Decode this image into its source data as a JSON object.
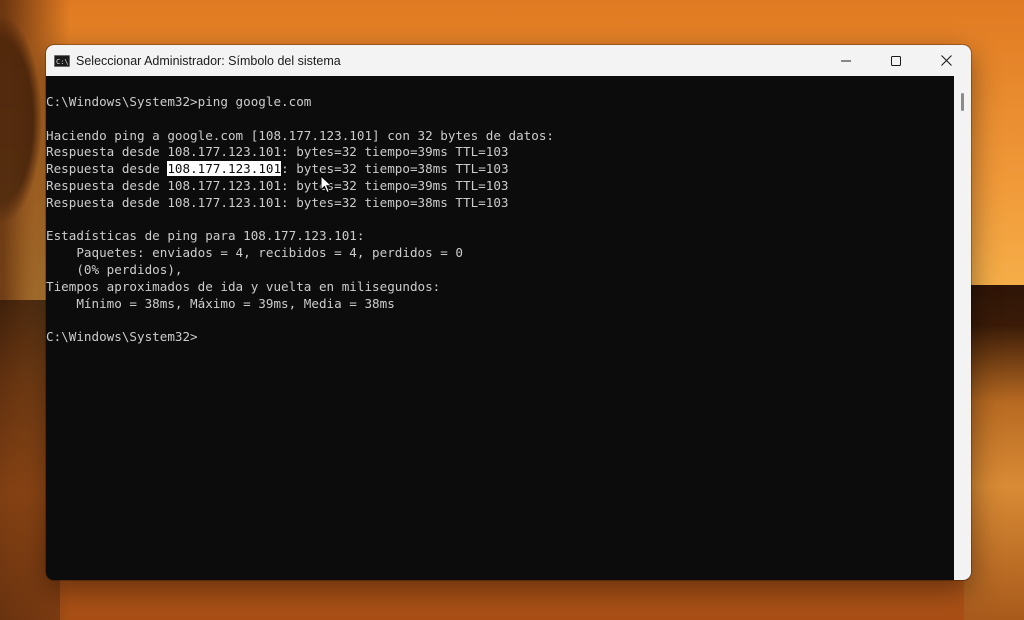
{
  "window": {
    "title": "Seleccionar Administrador: Símbolo del sistema",
    "icon": "cmd-icon",
    "icon_text": "C:\\",
    "controls": [
      "minimize-icon",
      "maximize-icon",
      "close-icon"
    ]
  },
  "console": {
    "lines": [
      {
        "text": "C:\\Windows\\System32>ping google.com"
      },
      {
        "text": ""
      },
      {
        "text": "Haciendo ping a google.com [108.177.123.101] con 32 bytes de datos:"
      },
      {
        "text": "Respuesta desde 108.177.123.101: bytes=32 tiempo=39ms TTL=103"
      },
      {
        "pre": "Respuesta desde ",
        "selected": "108.177.123.101",
        "post": ": bytes=32 tiempo=38ms TTL=103"
      },
      {
        "text": "Respuesta desde 108.177.123.101: bytes=32 tiempo=39ms TTL=103"
      },
      {
        "text": "Respuesta desde 108.177.123.101: bytes=32 tiempo=38ms TTL=103"
      },
      {
        "text": ""
      },
      {
        "text": "Estadísticas de ping para 108.177.123.101:"
      },
      {
        "text": "    Paquetes: enviados = 4, recibidos = 4, perdidos = 0"
      },
      {
        "text": "    (0% perdidos),"
      },
      {
        "text": "Tiempos aproximados de ida y vuelta en milisegundos:"
      },
      {
        "text": "    Mínimo = 38ms, Máximo = 39ms, Media = 38ms"
      },
      {
        "text": ""
      },
      {
        "text": "C:\\Windows\\System32>"
      }
    ]
  },
  "colors": {
    "console_bg": "#0c0c0c",
    "console_fg": "#cccccc",
    "selection_bg": "#ffffff",
    "titlebar_bg": "#f3f3f3"
  }
}
